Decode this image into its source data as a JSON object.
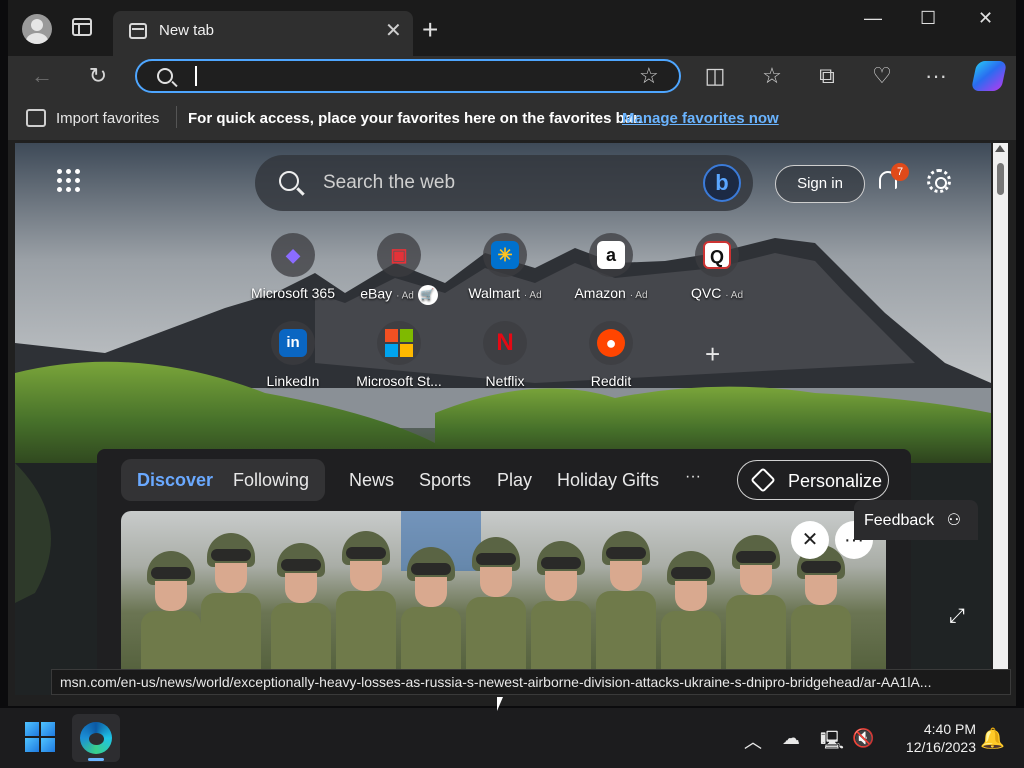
{
  "tab": {
    "title": "New tab"
  },
  "window_controls": {
    "minimize": "—",
    "maximize": "☐",
    "close": "✕"
  },
  "addressbar": {
    "value": "",
    "placeholder": ""
  },
  "favorites_bar": {
    "import_label": "Import favorites",
    "message": "For quick access, place your favorites here on the favorites bar.",
    "link": "Manage favorites now"
  },
  "newtab": {
    "search_placeholder": "Search the web",
    "signin_label": "Sign in",
    "notification_count": "7",
    "quick_links": [
      {
        "label": "Microsoft 365",
        "ad": "",
        "icon": "microsoft-365-icon",
        "color": "#7a5cf0",
        "glyph": "◆"
      },
      {
        "label": "eBay",
        "ad": "· Ad",
        "icon": "ebay-icon",
        "color": "#e53238",
        "glyph": "▣"
      },
      {
        "label": "Walmart",
        "ad": "· Ad",
        "icon": "walmart-icon",
        "color": "#0071ce",
        "glyph": "✳"
      },
      {
        "label": "Amazon",
        "ad": "· Ad",
        "icon": "amazon-icon",
        "color": "#ffffff",
        "glyph": "a"
      },
      {
        "label": "QVC",
        "ad": "· Ad",
        "icon": "qvc-icon",
        "color": "#ffffff",
        "glyph": "Q"
      },
      {
        "label": "LinkedIn",
        "ad": "",
        "icon": "linkedin-icon",
        "color": "#0a66c2",
        "glyph": "in"
      },
      {
        "label": "Microsoft St...",
        "ad": "",
        "icon": "microsoft-store-icon",
        "color": "#f25022",
        "glyph": "▦"
      },
      {
        "label": "Netflix",
        "ad": "",
        "icon": "netflix-icon",
        "color": "#e50914",
        "glyph": "N"
      },
      {
        "label": "Reddit",
        "ad": "",
        "icon": "reddit-icon",
        "color": "#ff4500",
        "glyph": "●"
      }
    ],
    "add_site": "+"
  },
  "feed": {
    "tabs": [
      "Discover",
      "Following"
    ],
    "nav": [
      "News",
      "Sports",
      "Play",
      "Holiday Gifts"
    ],
    "more": "···",
    "personalize_label": "Personalize"
  },
  "feedback_label": "Feedback",
  "status_url": "msn.com/en-us/news/world/exceptionally-heavy-losses-as-russia-s-newest-airborne-division-attacks-ukraine-s-dnipro-bridgehead/ar-AA1lA...",
  "taskbar": {
    "time": "4:40 PM",
    "date": "12/16/2023"
  },
  "colors": {
    "accent": "#4ea6ff",
    "link": "#6ab4ff",
    "badge": "#e04a1a"
  }
}
